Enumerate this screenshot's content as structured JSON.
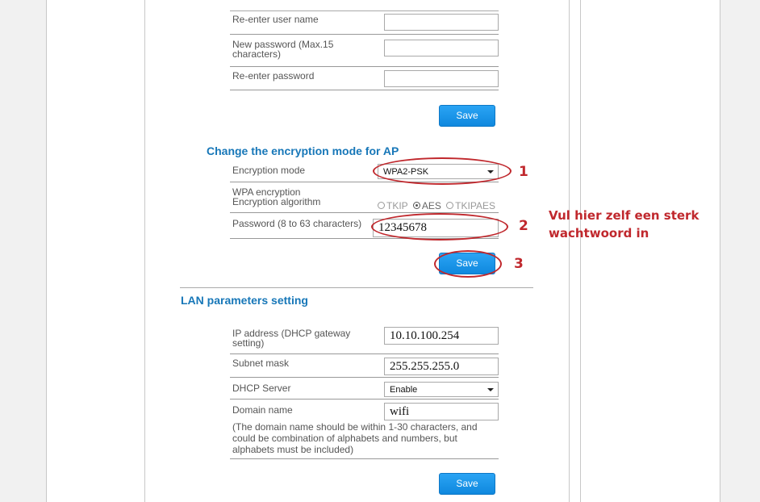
{
  "account_section": {
    "reenter_user_label": "Re-enter user name",
    "new_password_label": "New password (Max.15 characters)",
    "reenter_password_label": "Re-enter password",
    "save_label": "Save"
  },
  "encryption_section": {
    "heading": "Change the encryption mode for AP",
    "mode_label": "Encryption mode",
    "mode_value": "WPA2-PSK",
    "algorithm_label": "WPA encryption Encryption algorithm",
    "algorithms": [
      "TKIP",
      "AES",
      "TKIPAES"
    ],
    "selected_algorithm": "AES",
    "password_label": "Password (8 to 63 characters)",
    "password_value": "12345678",
    "save_label": "Save"
  },
  "lan_section": {
    "heading": "LAN parameters setting",
    "ip_label": "IP address (DHCP gateway setting)",
    "ip_value": "10.10.100.254",
    "subnet_label": "Subnet mask",
    "subnet_value": "255.255.255.0",
    "dhcp_label": "DHCP Server",
    "dhcp_value": "Enable",
    "domain_label": "Domain name",
    "domain_value": "wifi",
    "domain_note": "(The domain name should be within 1-30 characters, and could be combination of alphabets and numbers, but alphabets must be included)",
    "save_label": "Save"
  },
  "annotations": {
    "step1": "1",
    "step2": "2",
    "step3": "3",
    "callout": "Vul hier zelf een sterk wachtwoord in",
    "color": "#c0282d"
  }
}
